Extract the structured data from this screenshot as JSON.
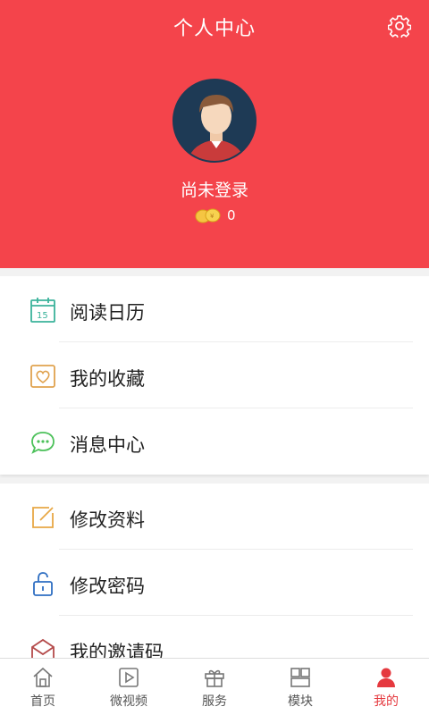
{
  "header": {
    "title": "个人中心",
    "login_status": "尚未登录",
    "coin_count": "0",
    "settings_icon": "gear-icon",
    "bg_color": "#f4444b"
  },
  "menu_group_1": [
    {
      "label": "阅读日历",
      "icon": "calendar-icon",
      "icon_text": "15",
      "color": "#3bb39b"
    },
    {
      "label": "我的收藏",
      "icon": "heart-icon",
      "color": "#e0a24e"
    },
    {
      "label": "消息中心",
      "icon": "chat-bubble-icon",
      "color": "#4cc15a"
    }
  ],
  "menu_group_2": [
    {
      "label": "修改资料",
      "icon": "edit-icon",
      "color": "#e8a845"
    },
    {
      "label": "修改密码",
      "icon": "unlock-icon",
      "color": "#2f6fc2"
    },
    {
      "label": "我的邀请码",
      "icon": "invite-envelope-icon",
      "color": "#b44a4a"
    }
  ],
  "tabbar": {
    "tabs": [
      {
        "label": "首页",
        "icon": "home-icon"
      },
      {
        "label": "微视频",
        "icon": "video-icon"
      },
      {
        "label": "服务",
        "icon": "gift-icon"
      },
      {
        "label": "模块",
        "icon": "modules-icon"
      },
      {
        "label": "我的",
        "icon": "user-icon",
        "active": true
      }
    ],
    "active_color": "#e5393f"
  }
}
